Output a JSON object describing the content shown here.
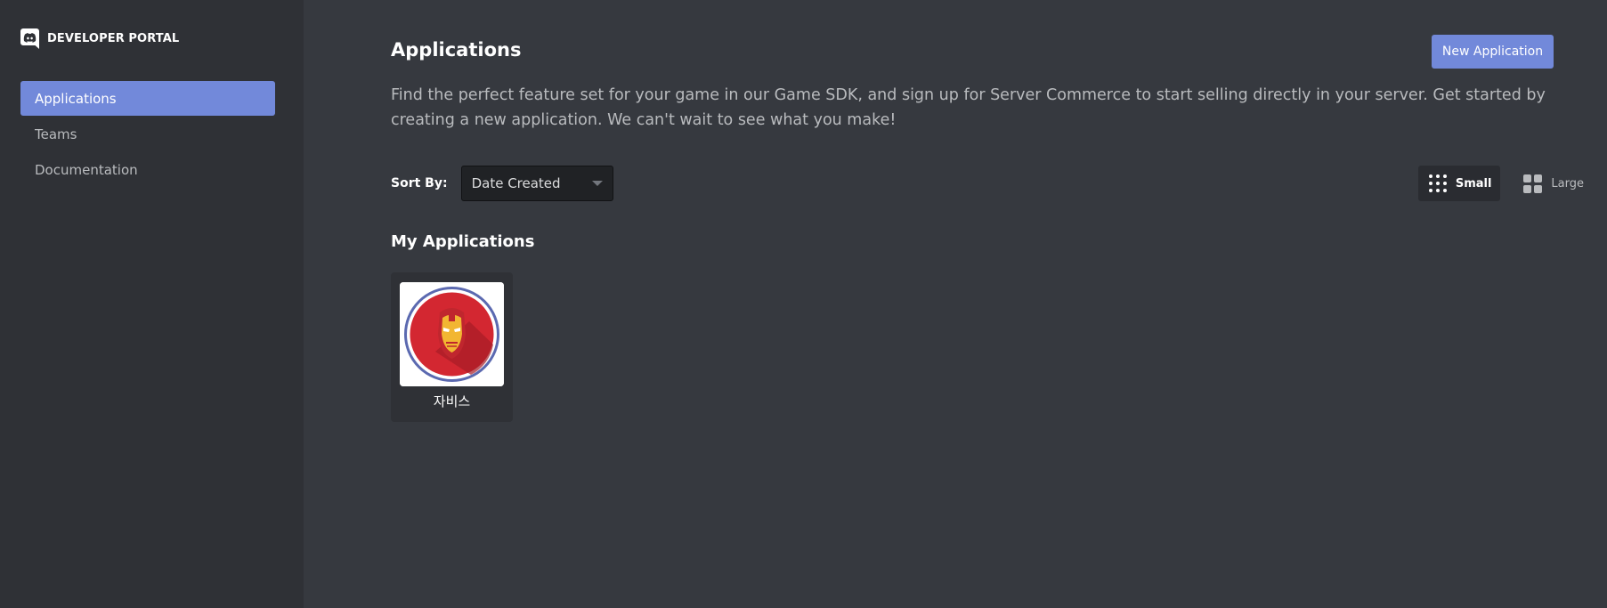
{
  "brand": {
    "title": "DEVELOPER PORTAL",
    "icon": "discord-logo-icon"
  },
  "sidebar": {
    "items": [
      {
        "label": "Applications",
        "active": true
      },
      {
        "label": "Teams",
        "active": false
      },
      {
        "label": "Documentation",
        "active": false
      }
    ]
  },
  "header": {
    "title": "Applications",
    "new_button_label": "New Application",
    "description": "Find the perfect feature set for your game in our Game SDK, and sign up for Server Commerce to start selling directly in your server. Get started by creating a new application. We can't wait to see what you make!"
  },
  "sort": {
    "label": "Sort By:",
    "selected": "Date Created"
  },
  "view": {
    "options": [
      {
        "label": "Small",
        "icon": "small-grid-icon",
        "active": true
      },
      {
        "label": "Large",
        "icon": "large-grid-icon",
        "active": false
      }
    ]
  },
  "applications": {
    "section_title": "My Applications",
    "items": [
      {
        "name": "자비스",
        "icon": "iron-man-helmet-icon"
      }
    ]
  },
  "colors": {
    "accent": "#7289da",
    "sidebar_bg": "#2f3136",
    "main_bg": "#36393f",
    "select_bg": "#202225"
  }
}
